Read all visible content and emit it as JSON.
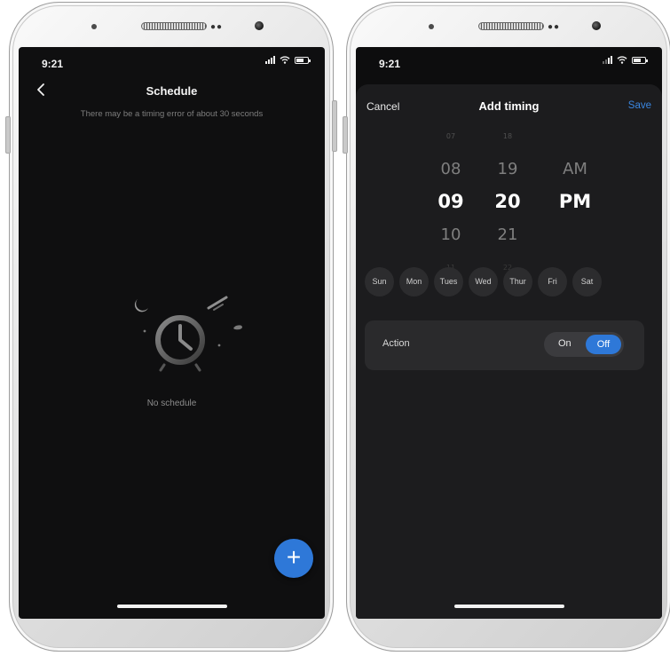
{
  "left_phone": {
    "status_time": "9:21",
    "header": {
      "title": "Schedule",
      "subtitle": "There may be a timing error of about 30 seconds"
    },
    "empty_state": {
      "text": "No schedule"
    },
    "fab_label": "+"
  },
  "right_phone": {
    "status_time": "9:21",
    "header": {
      "cancel": "Cancel",
      "title": "Add timing",
      "save": "Save"
    },
    "picker": {
      "hours": [
        "07",
        "08",
        "09",
        "10",
        "11"
      ],
      "minutes": [
        "18",
        "19",
        "20",
        "21",
        "22"
      ],
      "periods": [
        "AM",
        "PM"
      ],
      "selected_hour": "09",
      "selected_minute": "20",
      "selected_period": "PM"
    },
    "days": [
      "Sun",
      "Mon",
      "Tues",
      "Wed",
      "Thur",
      "Fri",
      "Sat"
    ],
    "action": {
      "label": "Action",
      "on_label": "On",
      "off_label": "Off",
      "selected": "Off"
    }
  },
  "colors": {
    "accent": "#2e78d8",
    "screen_bg": "#0f0f10",
    "sheet_bg": "#1c1c1e",
    "card_bg": "#2a2a2c",
    "day_bg": "#2c2c2e"
  },
  "icons": [
    "back-chevron-icon",
    "signal-icon",
    "wifi-icon",
    "battery-icon",
    "alarm-clock-icon",
    "moon-icon",
    "plus-icon"
  ]
}
